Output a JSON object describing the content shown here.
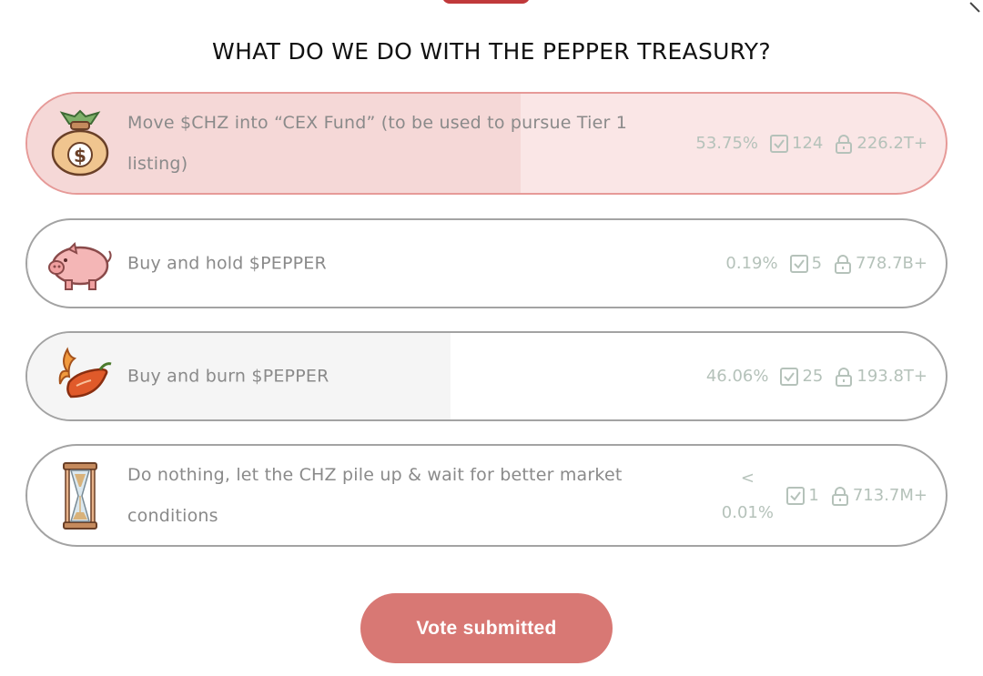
{
  "title": "WHAT DO WE DO WITH THE PEPPER TREASURY?",
  "options": [
    {
      "label": "Move $CHZ into “CEX Fund” (to be used to pursue Tier 1 listing)",
      "percent_text": "53.75%",
      "percent_value": 53.75,
      "votes": "124",
      "locked": "226.2T+",
      "icon": "money-bag-icon",
      "selected": true
    },
    {
      "label": "Buy and hold $PEPPER",
      "percent_text": "0.19%",
      "percent_value": 0.19,
      "votes": "5",
      "locked": "778.7B+",
      "icon": "piggy-bank-icon",
      "selected": false
    },
    {
      "label": "Buy and burn $PEPPER",
      "percent_text": "46.06%",
      "percent_value": 46.06,
      "votes": "25",
      "locked": "193.8T+",
      "icon": "flaming-pepper-icon",
      "selected": false
    },
    {
      "label": "Do nothing, let the CHZ pile up & wait for better market conditions",
      "percent_prefix": "<",
      "percent_text": "0.01%",
      "percent_value": 0.01,
      "votes": "1",
      "locked": "713.7M+",
      "icon": "hourglass-icon",
      "selected": false
    }
  ],
  "stat_icons": {
    "votes": "checkbox-icon",
    "locked": "lock-icon"
  },
  "vote_button": {
    "label": "Vote submitted"
  },
  "colors": {
    "accent": "#d87874",
    "selected_border": "#e69a98",
    "selected_fill": "#f5d8d7",
    "stat_text": "#b5c2ba"
  }
}
